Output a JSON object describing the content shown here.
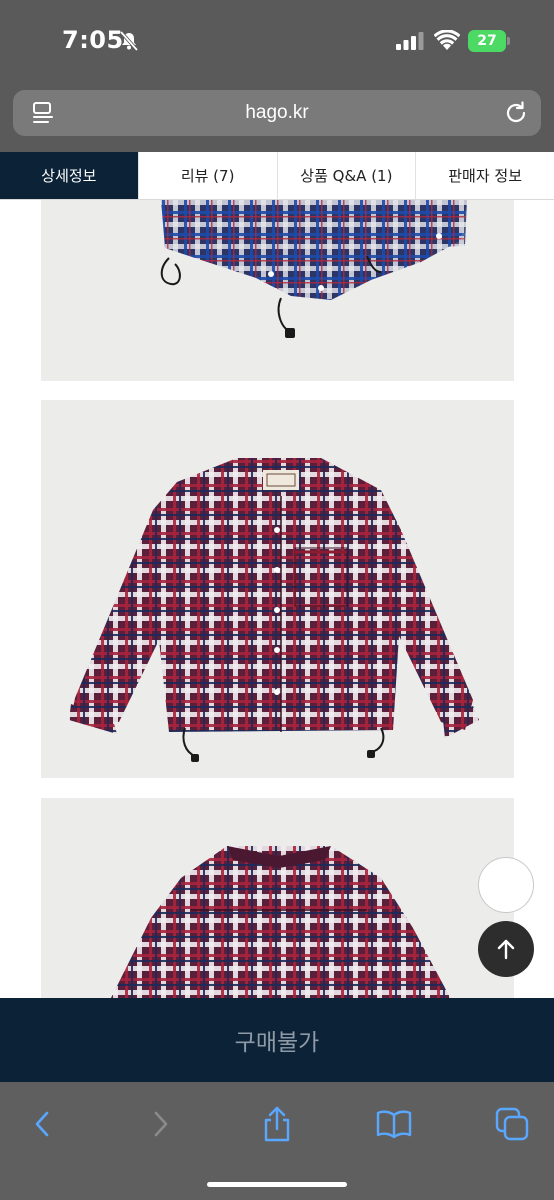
{
  "status_bar": {
    "time": "7:05",
    "battery": "27"
  },
  "browser": {
    "url": "hago.kr"
  },
  "tabs": [
    {
      "label": "상세정보",
      "active": true
    },
    {
      "label": "리뷰 (7)",
      "active": false
    },
    {
      "label": "상품 Q&A (1)",
      "active": false
    },
    {
      "label": "판매자 정보",
      "active": false
    }
  ],
  "purchase": {
    "label": "구매불가"
  },
  "colors": {
    "navy": "#0b2237",
    "battery_green": "#4cd964",
    "chrome_gray": "#5a5a5a"
  },
  "icons": {
    "back": "chevron-left-icon",
    "forward": "chevron-right-icon",
    "share": "share-icon",
    "bookmarks": "book-icon",
    "tabs": "tabs-icon",
    "scroll_top": "arrow-up-icon"
  }
}
